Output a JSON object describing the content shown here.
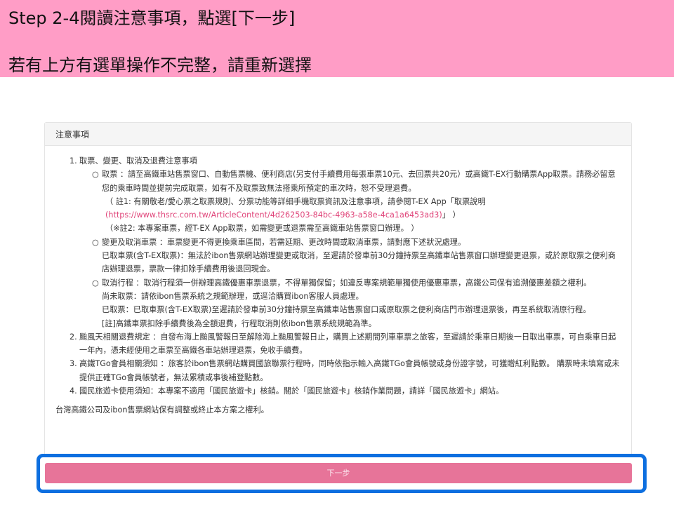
{
  "banner": {
    "line1": "Step 2-4閱讀注意事項，點選[下一步]",
    "line2": "若有上方有選單操作不完整，請重新選擇"
  },
  "panel": {
    "heading": "注意事項",
    "items": [
      {
        "num": "1.",
        "title": "取票、變更、取消及退費注意事項",
        "subs": [
          {
            "bullet": "○",
            "text": "取票 ：請至高鐵車站售票窗口、自動售票機、便利商店(另支付手續費用每張車票10元、去回票共20元）或高鐵T-EX行動購票App取票。請務必留意您的乘車時間並提前完成取票，如有不及取票致無法搭乘所預定的車次時，恕不受理退費。",
            "note1_prefix": "（ 註1: 有關敬老/愛心票之取票規則、分票功能等詳細手機取票資訊及注意事項，請參閱T-EX App「取票說明",
            "note1_link": "(https://www.thsrc.com.tw/ArticleContent/4d262503-84bc-4963-a58e-4ca1a6453ad3)",
            "note1_suffix": "」 ）",
            "note2": "（※註2: 本專案車票，經T-EX App取票，如需變更或退票需至高鐵車站售票窗口辦理。 ）"
          },
          {
            "bullet": "○",
            "text": "變更及取消車票 ：車票變更不得更換乘車區間，若需延期、更改時間或取消車票，請對應下述狀況處理。",
            "extra": "已取車票(含T-EX取票)：無法於ibon售票網站辦理變更或取消，至遲請於發車前30分鐘持票至高鐵車站售票窗口辦理變更退票，或於原取票之便利商店辦理退票，票款一律扣除手續費用後退回現金。"
          },
          {
            "bullet": "○",
            "text": "取消行程 ：取消行程須一併辦理高鐵優惠車票退票，不得單獨保留；如違反專案規範單獨使用優惠車票，高鐵公司保有追溯優惠差額之權利。",
            "extra1": "尚未取票：請依ibon售票系統之規範辦理，或逕洽購買ibon客服人員處理。",
            "extra2": "已取票：已取車票(含T-EX取票)至遲請於發車前30分鐘持票至高鐵車站售票窗口或原取票之便利商店門市辦理退票後，再至系統取消原行程。",
            "extra3": "[註]高鐵車票扣除手續費後為全額退費，行程取消則依ibon售票系統規範為準。"
          }
        ]
      },
      {
        "num": "2.",
        "text": "颱風天相關退費規定 ：自發布海上颱風警報日至解除海上颱風警報日止，購買上述期間列車車票之旅客，至遲請於乘車日期後一日取出車票，可自乘車日起一年內，憑未經使用之車票至高鐵各車站辦理退票，免收手續費。"
      },
      {
        "num": "3.",
        "text": "高鐵TGo會員相關須知 ：旅客於ibon售票網站購買國旅聯票行程時，同時依指示輸入高鐵TGo會員帳號或身份證字號，可獲贈紅利點數。 購票時未填寫或未提供正確TGo會員帳號者，無法累積或事後補登點數。"
      },
      {
        "num": "4.",
        "text": "國民旅遊卡使用須知：本專案不適用「國民旅遊卡」核銷。關於「國民旅遊卡」核銷作業問題，請詳「國民旅遊卡」網站。"
      }
    ],
    "footer": "台灣高鐵公司及ibon售票網站保有調整或終止本方案之權利。"
  },
  "next_button": {
    "label": "下一步"
  },
  "colors": {
    "banner": "#ff9dc6",
    "link": "#e0457a",
    "button": "#e77499",
    "highlight": "#0d6fe0"
  }
}
